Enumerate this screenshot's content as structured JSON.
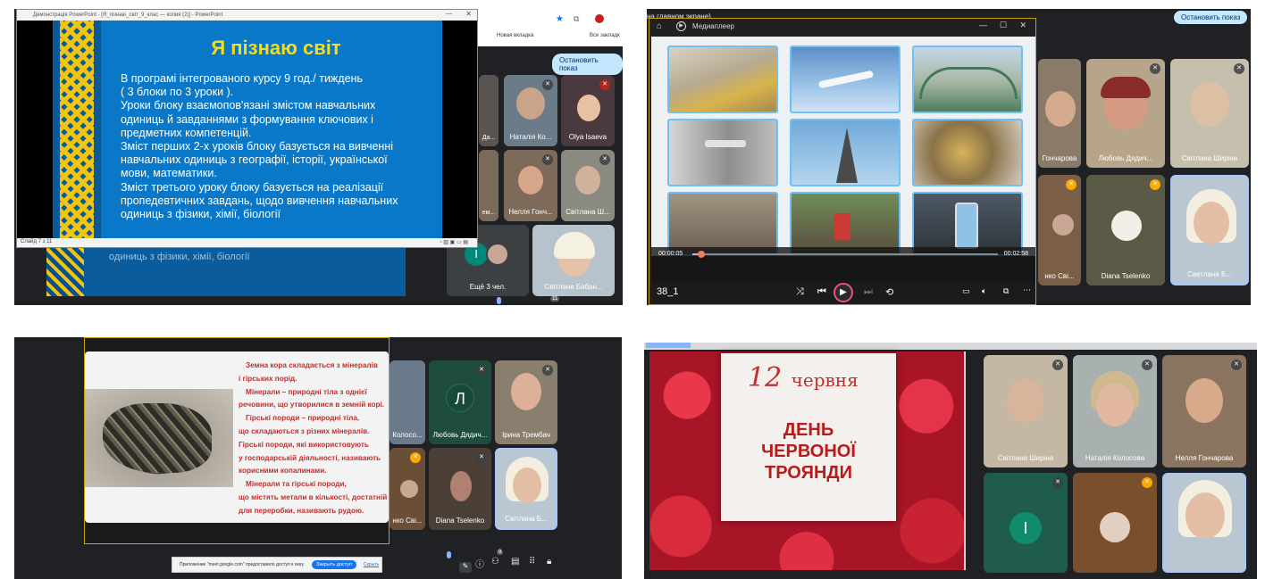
{
  "q1": {
    "window_title": "Демонстрація PowerPoint - [Я_пізнаю_світ_9_клас — копия (2)] - PowerPoint",
    "slide_title": "Я пізнаю світ",
    "slide_lines": [
      "В програмі інтегрованого курсу 9 год./ тиждень",
      "( 3 блоки по 3 уроки ).",
      "Уроки блоку взаємопов'язані змістом навчальних",
      "одиниць й завданнями з формування ключових і",
      "предметних компетенцій.",
      "Зміст перших 2-х уроків блоку базується на вивченні",
      "навчальних одиниць з географії, історії, української",
      "мови, математики.",
      "Зміст третього уроку блоку базується на реалізації",
      "пропедевтичних  завдань, щодо вивчення навчальних",
      "одиниць з фізики, хімії, біології"
    ],
    "slide_counter": "Слайд 7 з 11",
    "behind_text": "одиниць з фізики, хімії, біології",
    "browser_new_tab": "Новая вкладка",
    "browser_all_bookmarks": "Все закладк",
    "stop_button": "Остановить показ",
    "participants": [
      "Да...",
      "Наталія Ко...",
      "Olya Isaeva",
      "ем...",
      "Нелля Гонч...",
      "Світлана Ш...",
      "Ещё 3 чел.",
      "Світлана Бабан..."
    ],
    "more_letter": "I",
    "badge": "11"
  },
  "q2": {
    "header_fragment": "на главном экране)",
    "stop_button": "Остановить показ",
    "player_title": "Медиаплеер",
    "time_current": "00:00:05",
    "time_total": "00:02:58",
    "track_name": "38_1",
    "progress": 0.03,
    "participants": [
      "Гончарова",
      "Любовь Дядич...",
      "Світлана Ширіна",
      "нко Сві...",
      "Diana Tselenko",
      "Светлана Б..."
    ]
  },
  "q3": {
    "slide_lines": [
      "Земна кора складається з мінералів",
      "і гірських порід.",
      "Мінерали – природні тіла з однієї",
      "речовини, що утворилися в земній корі.",
      "Гірські породи – природні тіла,",
      "що складаються з різних мінералів.",
      "Гірські породи, які використовують",
      "у господарській діяльності, називають",
      "корисними копалинами.",
      "Мінерали та гірські породи,",
      "що містять метали в кількості, достатній",
      "для переробки, називають рудою."
    ],
    "participants": [
      "Колосо...",
      "Любовь Дядич...",
      "Ірина Трембач",
      "нко Сві...",
      "Diana Tselenko",
      "Світлана Б..."
    ],
    "avatar_letter": "Л",
    "banner_text": "Приложение \"meet.google.com\" предоставило доступ к окну.",
    "banner_button": "Закрыть доступ",
    "banner_hide": "Скрыть",
    "badge": "9"
  },
  "q4": {
    "date_number": "12",
    "date_month": "червня",
    "title_lines": [
      "ДЕНЬ",
      "ЧЕРВОНОЇ",
      "ТРОЯНДИ"
    ],
    "participants": [
      "Світлана Ширіна",
      "Наталія Колосова",
      "Нелля Гончарова",
      "",
      "",
      ""
    ],
    "avatar_letter": "I"
  },
  "colors": {
    "meet_bg": "#202124",
    "tile_bg": "#3c4043",
    "slide_blue": "#0a78c8",
    "slide_title_yellow": "#f5dc1e",
    "rose_text_red": "#c0302f",
    "stop_button_bg": "#c2e7ff"
  }
}
